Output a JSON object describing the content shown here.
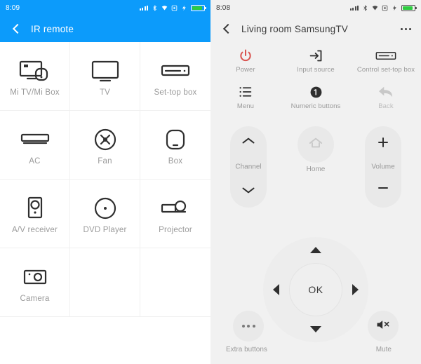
{
  "left_panel": {
    "status": {
      "time": "8:09",
      "icons": [
        "signal-dots-icon",
        "bluetooth-icon",
        "wifi-icon",
        "screenshot-icon",
        "charging-bolt-icon",
        "battery-icon"
      ]
    },
    "appbar": {
      "back_label": "back-chevron",
      "title": "IR remote"
    },
    "devices": [
      {
        "label": "Mi TV/Mi Box",
        "icon": "mi-tv-mi-box-icon"
      },
      {
        "label": "TV",
        "icon": "tv-icon"
      },
      {
        "label": "Set-top box",
        "icon": "set-top-box-icon"
      },
      {
        "label": "AC",
        "icon": "air-conditioner-icon"
      },
      {
        "label": "Fan",
        "icon": "fan-icon"
      },
      {
        "label": "Box",
        "icon": "box-icon"
      },
      {
        "label": "A/V receiver",
        "icon": "av-receiver-icon"
      },
      {
        "label": "DVD Player",
        "icon": "dvd-player-icon"
      },
      {
        "label": "Projector",
        "icon": "projector-icon"
      },
      {
        "label": "Camera",
        "icon": "camera-icon"
      }
    ]
  },
  "right_panel": {
    "status": {
      "time": "8:08",
      "icons": [
        "signal-dots-icon",
        "bluetooth-icon",
        "wifi-icon",
        "screenshot-icon",
        "charging-bolt-icon",
        "battery-icon"
      ]
    },
    "appbar": {
      "back_label": "back-chevron",
      "title": "Living room SamsungTV",
      "more_label": "more-options"
    },
    "functions": [
      {
        "label": "Power",
        "icon": "power-icon",
        "color": "#d9534f",
        "disabled": false
      },
      {
        "label": "Input source",
        "icon": "input-source-icon",
        "color": "#2f2f2f",
        "disabled": false
      },
      {
        "label": "Control set-top box",
        "icon": "set-top-box-icon",
        "color": "#2f2f2f",
        "disabled": false
      },
      {
        "label": "Menu",
        "icon": "menu-list-icon",
        "color": "#2f2f2f",
        "disabled": false
      },
      {
        "label": "Numeric buttons",
        "icon": "numeric-one-icon",
        "color": "#2f2f2f",
        "disabled": false
      },
      {
        "label": "Back",
        "icon": "back-arrow-icon",
        "color": "#c8c8c8",
        "disabled": true
      }
    ],
    "channel": {
      "label": "Channel",
      "up_icon": "chevron-up-icon",
      "down_icon": "chevron-down-icon"
    },
    "home": {
      "label": "Home",
      "icon": "home-icon"
    },
    "volume": {
      "label": "Volume",
      "up_icon": "plus-icon",
      "down_icon": "minus-icon"
    },
    "dpad": {
      "ok_label": "OK",
      "up": "arrow-up",
      "down": "arrow-down",
      "left": "arrow-left",
      "right": "arrow-right"
    },
    "extra": {
      "label": "Extra buttons",
      "icon": "ellipsis-icon"
    },
    "mute": {
      "label": "Mute",
      "icon": "mute-speaker-icon"
    }
  },
  "colors": {
    "accent_blue": "#0c9bfb",
    "panel_gray": "#f1f1f1",
    "power_red": "#d9534f",
    "battery_green": "#2ecc40"
  }
}
